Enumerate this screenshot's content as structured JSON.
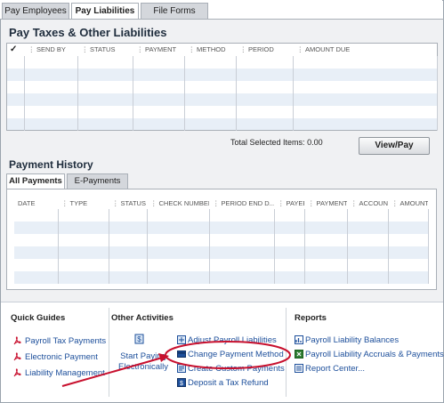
{
  "tabs": [
    {
      "label": "Pay Employees",
      "active": false
    },
    {
      "label": "Pay Liabilities",
      "active": true
    },
    {
      "label": "File Forms",
      "active": false
    }
  ],
  "pay_taxes": {
    "title": "Pay Taxes & Other Liabilities",
    "check_header": "✓",
    "columns": [
      "SEND BY",
      "STATUS",
      "PAYMENT",
      "METHOD",
      "PERIOD",
      "AMOUNT DUE"
    ],
    "total_label": "Total Selected Items:",
    "total_value": "0.00",
    "view_pay_button": "View/Pay"
  },
  "payment_history": {
    "title": "Payment History",
    "subtabs": [
      {
        "label": "All Payments",
        "active": true
      },
      {
        "label": "E-Payments",
        "active": false
      }
    ],
    "columns": [
      "DATE",
      "TYPE",
      "STATUS",
      "CHECK NUMBER",
      "PERIOD END D...",
      "PAYEE",
      "PAYMENT",
      "ACCOUNT",
      "AMOUNT"
    ]
  },
  "quick_guides": {
    "title": "Quick Guides",
    "items": [
      "Payroll Tax Payments",
      "Electronic Payment",
      "Liability Management"
    ]
  },
  "other_activities": {
    "title": "Other Activities",
    "start_paying_line1": "Start Paying",
    "start_paying_line2": "Electronically",
    "items": [
      "Adjust Payroll Liabilities",
      "Change Payment Method",
      "Create Custom Payments",
      "Deposit a Tax Refund"
    ]
  },
  "reports": {
    "title": "Reports",
    "items": [
      "Payroll Liability Balances",
      "Payroll Liability Accruals & Payments",
      "Report Center..."
    ]
  },
  "colors": {
    "link": "#1d4f9b",
    "annotation_red": "#c8102e",
    "row_alt": "#e8eff7"
  }
}
